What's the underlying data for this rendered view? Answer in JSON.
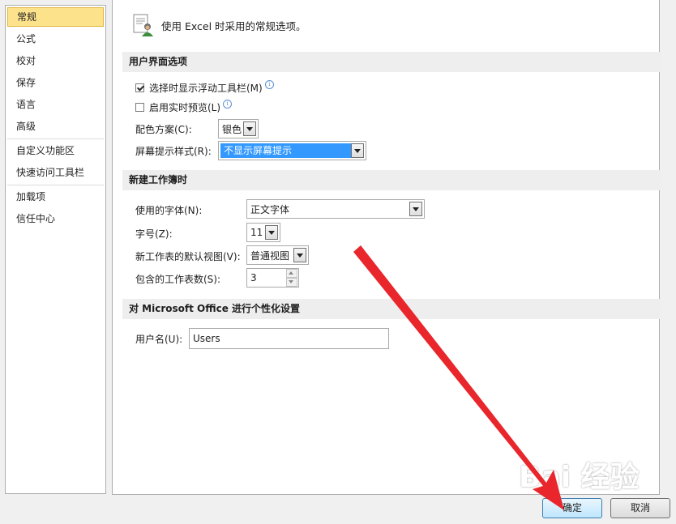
{
  "sidebar": {
    "items": [
      {
        "label": "常规",
        "active": true
      },
      {
        "label": "公式"
      },
      {
        "label": "校对"
      },
      {
        "label": "保存"
      },
      {
        "label": "语言"
      },
      {
        "label": "高级"
      },
      {
        "label": "自定义功能区"
      },
      {
        "label": "快速访问工具栏"
      },
      {
        "label": "加载项"
      },
      {
        "label": "信任中心"
      }
    ]
  },
  "intro": {
    "text": "使用 Excel 时采用的常规选项。"
  },
  "ui_section": {
    "title": "用户界面选项",
    "mini_toolbar": {
      "label": "选择时显示浮动工具栏(M)",
      "checked": true
    },
    "live_preview": {
      "label": "启用实时预览(L)",
      "checked": false
    },
    "color_scheme": {
      "label": "配色方案(C):",
      "value": "银色"
    },
    "screentip": {
      "label": "屏幕提示样式(R):",
      "value": "不显示屏幕提示"
    }
  },
  "workbook_section": {
    "title": "新建工作簿时",
    "font": {
      "label": "使用的字体(N):",
      "value": "正文字体"
    },
    "size": {
      "label": "字号(Z):",
      "value": "11"
    },
    "view": {
      "label": "新工作表的默认视图(V):",
      "value": "普通视图"
    },
    "sheets": {
      "label": "包含的工作表数(S):",
      "value": "3"
    }
  },
  "personalize_section": {
    "title": "对 Microsoft Office 进行个性化设置",
    "username": {
      "label": "用户名(U):",
      "value": "Users"
    }
  },
  "buttons": {
    "ok": "确定",
    "cancel": "取消"
  },
  "watermark": {
    "text": "Bai 经验"
  },
  "colors": {
    "accent_arrow": "#e8262b",
    "selected_nav": "#fde28c"
  }
}
